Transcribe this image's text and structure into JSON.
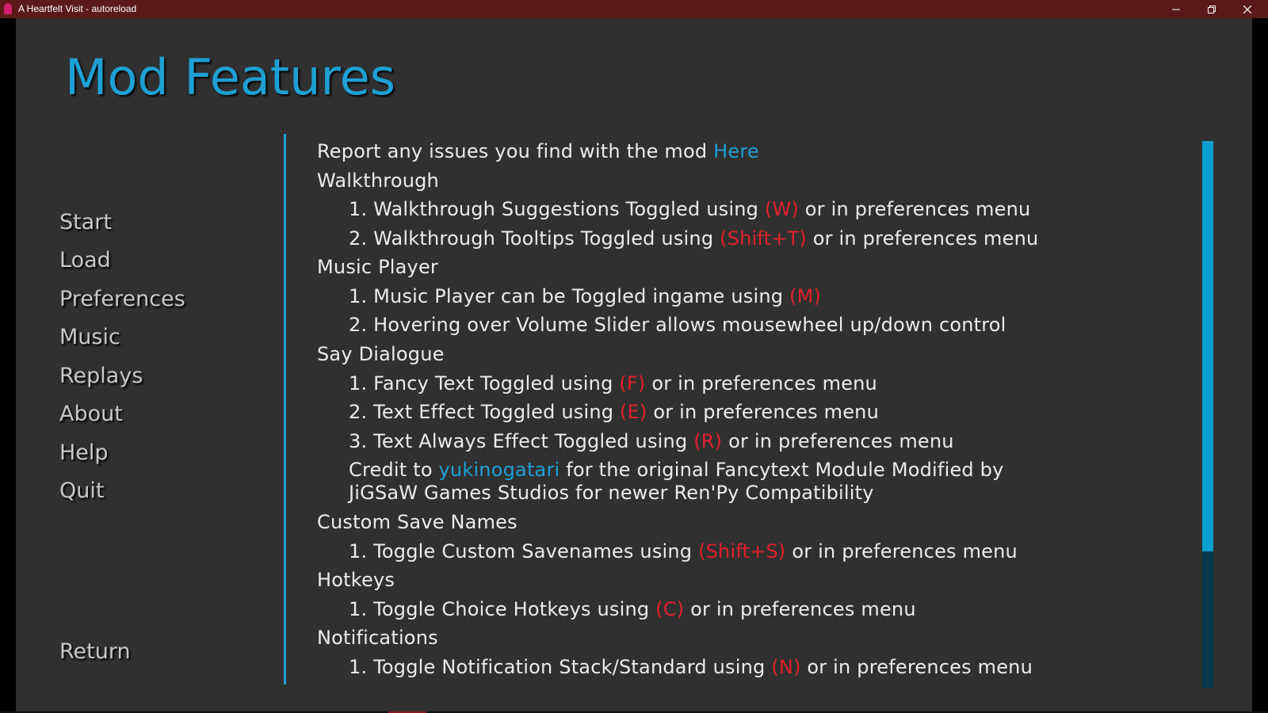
{
  "window": {
    "title": "A Heartfelt Visit - autoreload",
    "minimize_icon": "minimize-icon",
    "restore_icon": "restore-icon",
    "close_icon": "close-icon"
  },
  "colors": {
    "title_bar": "#5a1a1a",
    "background": "#303030",
    "accent": "#1ea0d4",
    "hotkey": "#e3202b",
    "text": "#ececec",
    "menu_text": "#c8c8c8"
  },
  "page_title": "Mod Features",
  "nav": {
    "items": [
      {
        "label": "Start"
      },
      {
        "label": "Load"
      },
      {
        "label": "Preferences"
      },
      {
        "label": "Music"
      },
      {
        "label": "Replays"
      },
      {
        "label": "About"
      },
      {
        "label": "Help"
      },
      {
        "label": "Quit"
      }
    ],
    "return_label": "Return"
  },
  "content": {
    "intro": {
      "text": "Report any issues you find with the mod ",
      "link": "Here"
    },
    "walkthrough": {
      "heading": "Walkthrough",
      "item1": {
        "pre": "1. Walkthrough Suggestions Toggled using ",
        "key": "(W)",
        "post": " or in preferences menu"
      },
      "item2": {
        "pre": "2. Walkthrough Tooltips Toggled using ",
        "key": "(Shift+T)",
        "post": " or in preferences menu"
      }
    },
    "music_player": {
      "heading": "Music Player",
      "item1": {
        "pre": "1. Music Player can be Toggled ingame using ",
        "key": "(M)"
      },
      "item2": {
        "text": "2. Hovering over Volume Slider allows mousewheel up/down control"
      }
    },
    "say_dialogue": {
      "heading": "Say Dialogue",
      "item1": {
        "pre": "1. Fancy Text Toggled using ",
        "key": "(F)",
        "post": " or in preferences menu"
      },
      "item2": {
        "pre": "2. Text Effect Toggled using ",
        "key": "(E)",
        "post": " or in preferences menu"
      },
      "item3": {
        "pre": "3. Text Always Effect Toggled using ",
        "key": "(R)",
        "post": " or in preferences menu"
      },
      "credit": {
        "pre": "Credit to ",
        "link": "yukinogatari",
        "post": " for the original Fancytext Module Modified by",
        "line2": "JiGSaW Games Studios for newer Ren'Py Compatibility"
      }
    },
    "custom_save_names": {
      "heading": "Custom Save Names",
      "item1": {
        "pre": "1. Toggle Custom Savenames using ",
        "key": "(Shift+S)",
        "post": " or in preferences menu"
      }
    },
    "hotkeys": {
      "heading": "Hotkeys",
      "item1": {
        "pre": "1. Toggle Choice Hotkeys using ",
        "key": "(C)",
        "post": " or in preferences menu"
      }
    },
    "notifications": {
      "heading": "Notifications",
      "item1": {
        "pre": "1. Toggle Notification Stack/Standard using ",
        "key": "(N)",
        "post": " or in preferences menu"
      }
    }
  },
  "scrollbar": {
    "position_fraction": 0.0,
    "visible_fraction": 0.75
  }
}
